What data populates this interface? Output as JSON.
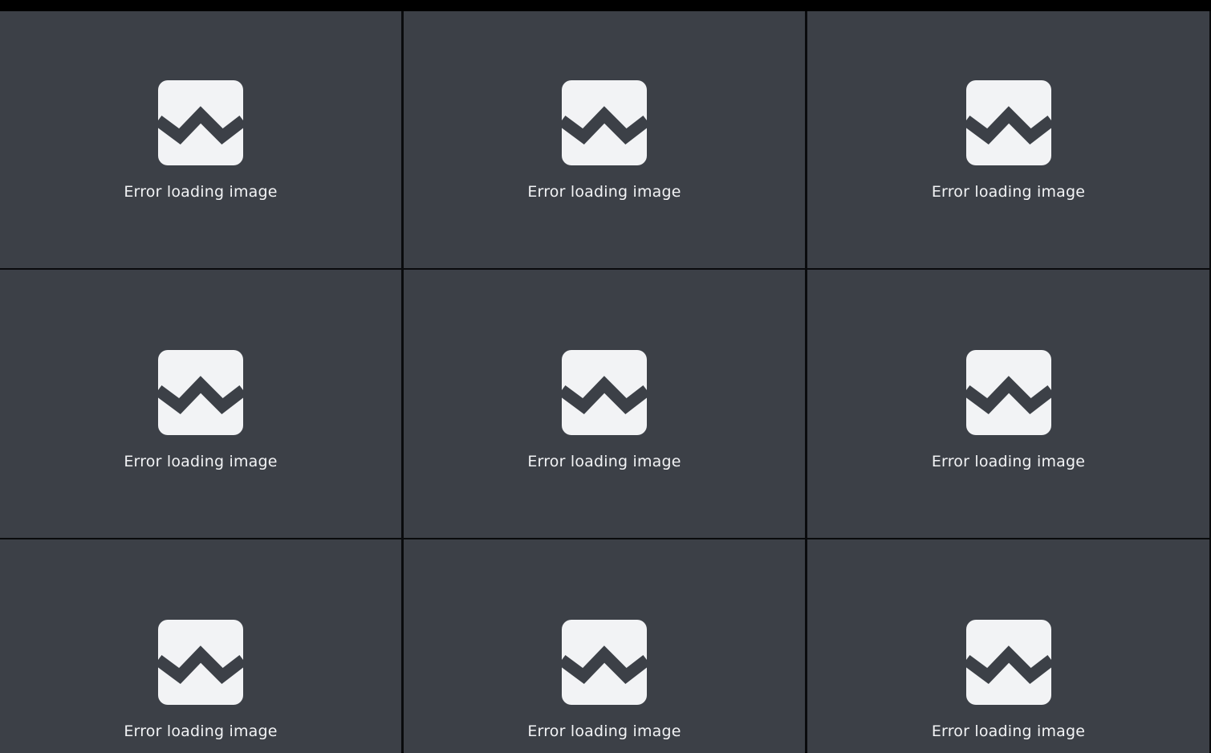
{
  "colors": {
    "tile_background": "#3c4047",
    "gutter": "#0a0b0d",
    "icon": "#f2f3f5",
    "label": "#f2f3f5"
  },
  "gallery": {
    "tiles": [
      {
        "icon": "broken-image-icon",
        "label": "Error loading image"
      },
      {
        "icon": "broken-image-icon",
        "label": "Error loading image"
      },
      {
        "icon": "broken-image-icon",
        "label": "Error loading image"
      },
      {
        "icon": "broken-image-icon",
        "label": "Error loading image"
      },
      {
        "icon": "broken-image-icon",
        "label": "Error loading image"
      },
      {
        "icon": "broken-image-icon",
        "label": "Error loading image"
      },
      {
        "icon": "broken-image-icon",
        "label": "Error loading image"
      },
      {
        "icon": "broken-image-icon",
        "label": "Error loading image"
      },
      {
        "icon": "broken-image-icon",
        "label": "Error loading image"
      }
    ]
  }
}
